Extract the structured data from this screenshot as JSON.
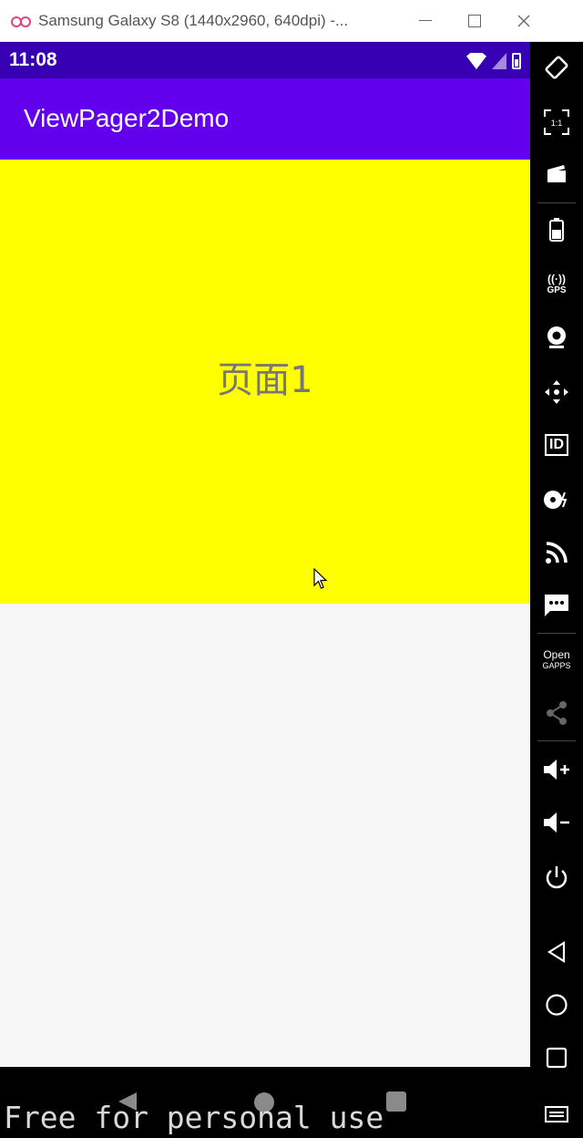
{
  "window": {
    "title": "Samsung Galaxy S8 (1440x2960, 640dpi) -...",
    "minimize_label": "—",
    "maximize_label": "□",
    "close_label": "✕"
  },
  "statusbar": {
    "time": "11:08"
  },
  "appbar": {
    "title": "ViewPager2Demo"
  },
  "page": {
    "label": "页面1"
  },
  "watermark": {
    "text": "Free for personal use"
  },
  "sidebar": {
    "open_gapps_line1": "Open",
    "open_gapps_line2": "GAPPS",
    "gps_label": "GPS",
    "id_label": "ID",
    "fullscreen_label": "1:1"
  },
  "colors": {
    "statusbar": "#3700b3",
    "appbar": "#6200ee",
    "page_background": "#ffff00",
    "content_background": "#f6f6f6"
  }
}
